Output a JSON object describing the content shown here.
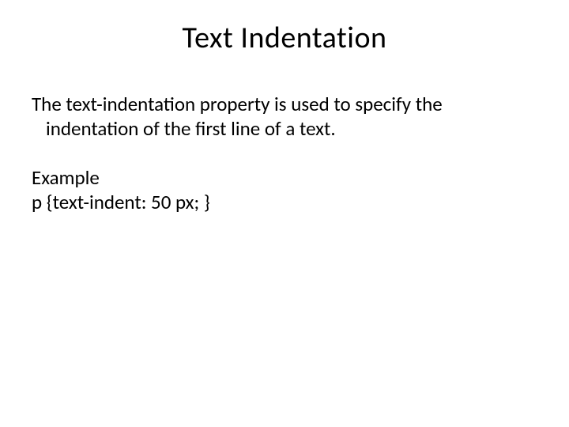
{
  "title": "Text Indentation",
  "body": "The text-indentation property is used to specify the indentation of the first line of a text.",
  "example_label": "Example",
  "example_code": "p {text-indent: 50 px; }"
}
